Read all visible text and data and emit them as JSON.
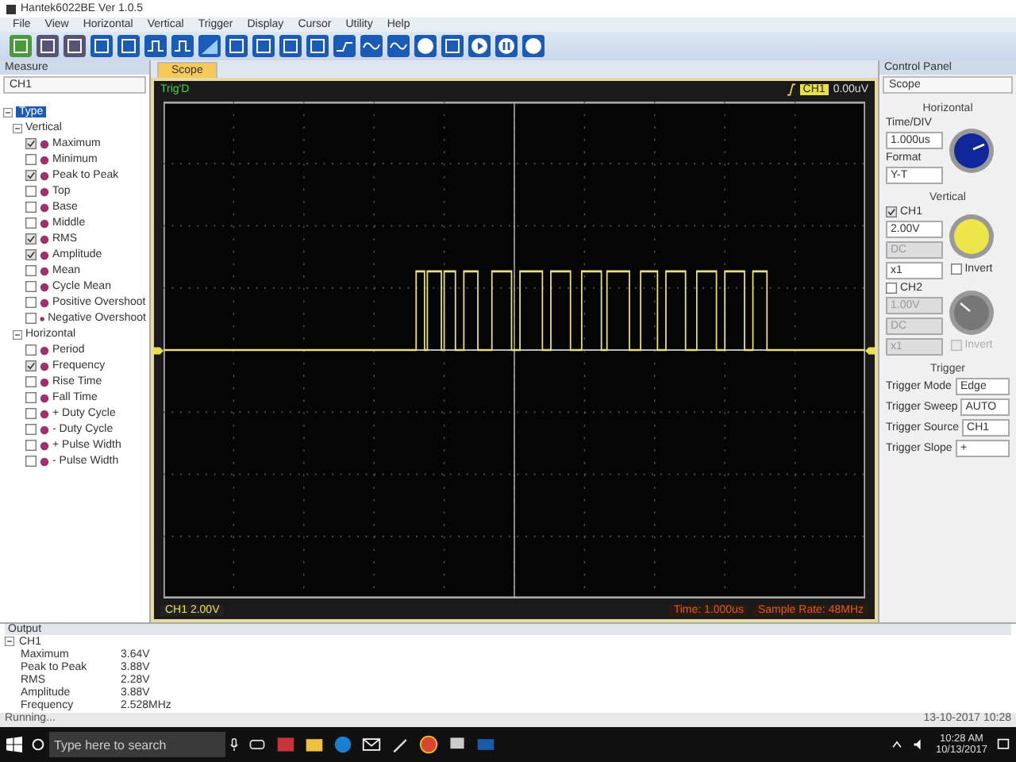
{
  "window": {
    "title": "Hantek6022BE Ver 1.0.5"
  },
  "menu": [
    "File",
    "View",
    "Horizontal",
    "Vertical",
    "Trigger",
    "Display",
    "Cursor",
    "Utility",
    "Help"
  ],
  "measure": {
    "title": "Measure",
    "channel": "CH1",
    "tree": {
      "label": "Type",
      "expanded": true,
      "children": [
        {
          "label": "Vertical",
          "expanded": true,
          "children": [
            {
              "label": "Maximum",
              "checked": true
            },
            {
              "label": "Minimum",
              "checked": false
            },
            {
              "label": "Peak to Peak",
              "checked": true
            },
            {
              "label": "Top",
              "checked": false
            },
            {
              "label": "Base",
              "checked": false
            },
            {
              "label": "Middle",
              "checked": false
            },
            {
              "label": "RMS",
              "checked": true
            },
            {
              "label": "Amplitude",
              "checked": true
            },
            {
              "label": "Mean",
              "checked": false
            },
            {
              "label": "Cycle Mean",
              "checked": false
            },
            {
              "label": "Positive Overshoot",
              "checked": false
            },
            {
              "label": "Negative Overshoot",
              "checked": false
            }
          ]
        },
        {
          "label": "Horizontal",
          "expanded": true,
          "children": [
            {
              "label": "Period",
              "checked": false
            },
            {
              "label": "Frequency",
              "checked": true
            },
            {
              "label": "Rise Time",
              "checked": false
            },
            {
              "label": "Fall Time",
              "checked": false
            },
            {
              "label": "+ Duty Cycle",
              "checked": false
            },
            {
              "label": "- Duty Cycle",
              "checked": false
            },
            {
              "label": "+ Pulse Width",
              "checked": false
            },
            {
              "label": "- Pulse Width",
              "checked": false
            }
          ]
        }
      ]
    }
  },
  "tabs": [
    {
      "label": "Scope",
      "selected": true
    }
  ],
  "scope": {
    "status": "Trig'D",
    "trigger_channel": "CH1",
    "trigger_level": "0.00uV",
    "channel_label": "CH1",
    "channel_scale": "2.00V",
    "time": "Time: 1.000us",
    "sample_rate": "Sample Rate: 48MHz"
  },
  "control_panel": {
    "title": "Control Panel",
    "mode": "Scope",
    "horizontal": {
      "title": "Horizontal",
      "fields": [
        {
          "label": "Time/DIV",
          "value": "1.000us",
          "disabled": false
        },
        {
          "label": "Format",
          "value": "Y-T",
          "disabled": false
        }
      ]
    },
    "vertical": {
      "title": "Vertical",
      "channels": [
        {
          "label": "CH1",
          "checked": true,
          "fields": [
            {
              "value": "2.00V",
              "disabled": false
            },
            {
              "value": "DC",
              "disabled": true
            },
            {
              "value": "x1",
              "disabled": false
            }
          ],
          "invert": {
            "label": "Invert",
            "checked": false,
            "disabled": false
          }
        },
        {
          "label": "CH2",
          "checked": false,
          "fields": [
            {
              "value": "1.00V",
              "disabled": true
            },
            {
              "value": "DC",
              "disabled": true
            },
            {
              "value": "x1",
              "disabled": true
            }
          ],
          "invert": {
            "label": "Invert",
            "checked": false,
            "disabled": true
          }
        }
      ]
    },
    "trigger": {
      "title": "Trigger",
      "fields": [
        {
          "label": "Trigger Mode",
          "value": "Edge"
        },
        {
          "label": "Trigger Sweep",
          "value": "AUTO"
        },
        {
          "label": "Trigger Source",
          "value": "CH1"
        },
        {
          "label": "Trigger Slope",
          "value": "+"
        }
      ]
    }
  },
  "output": {
    "title": "Output",
    "group": "CH1",
    "expanded": true,
    "rows": [
      {
        "name": "Maximum",
        "value": "3.64V"
      },
      {
        "name": "Peak to Peak",
        "value": "3.88V"
      },
      {
        "name": "RMS",
        "value": "2.28V"
      },
      {
        "name": "Amplitude",
        "value": "3.88V"
      },
      {
        "name": "Frequency",
        "value": "2.528MHz"
      }
    ]
  },
  "status_bar": {
    "message": "Running...",
    "timestamp": "13-10-2017  10:28"
  },
  "taskbar": {
    "search_placeholder": "Type here to search",
    "time": "10:28 AM",
    "date": "10/13/2017"
  }
}
